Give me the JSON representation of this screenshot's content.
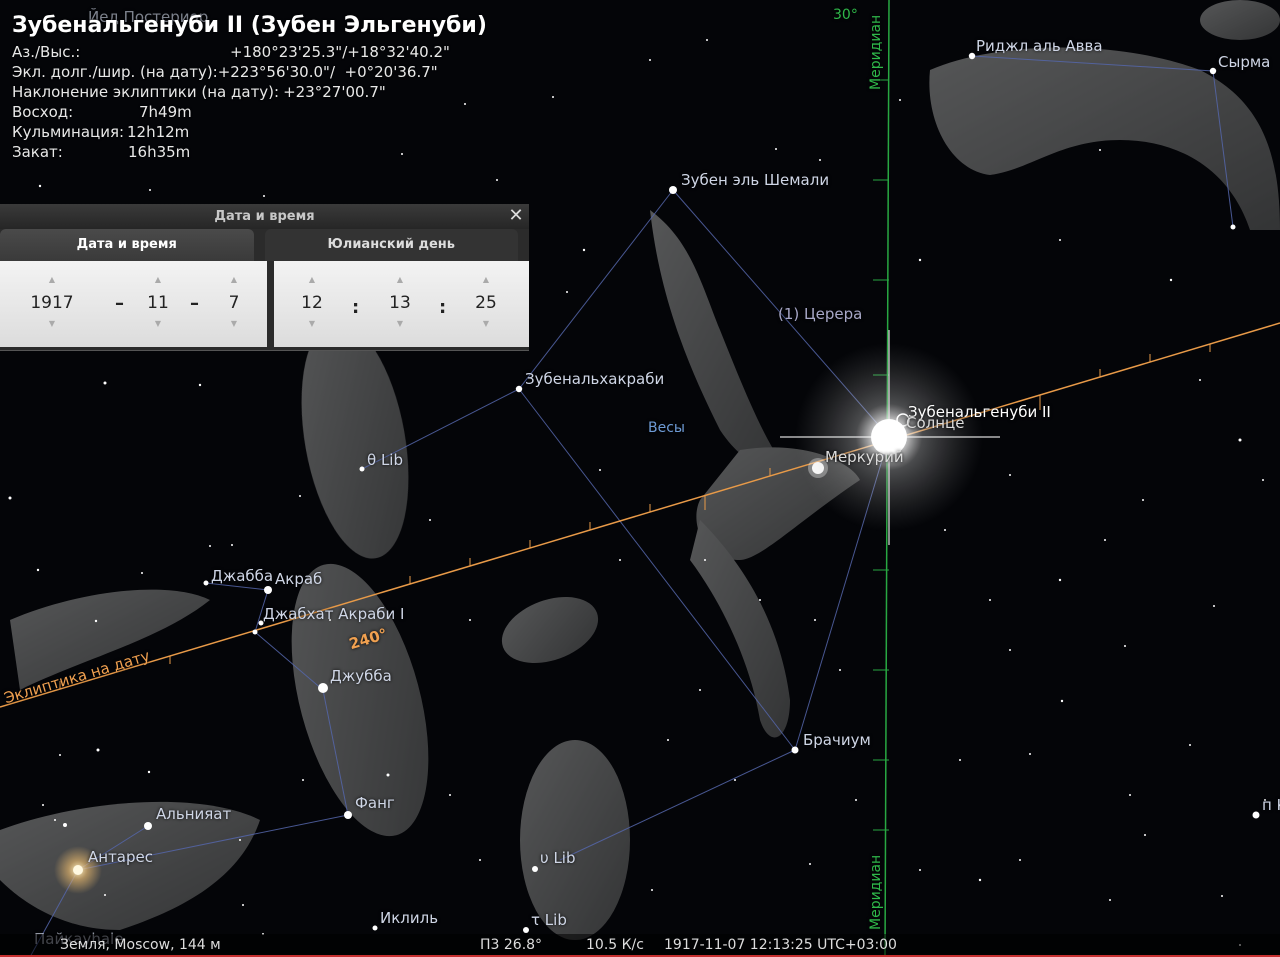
{
  "info": {
    "title": "Зубенальгенуби II (Зубен Эльгенуби)",
    "rows": [
      {
        "label": "Аз./Выс.:",
        "value": "+180°23'25.3\"/+18°32'40.2\""
      },
      {
        "label": "Экл. долг./шир. (на дату):",
        "value": "+223°56'30.0\"/  +0°20'36.7\""
      },
      {
        "label": "Наклонение эклиптики (на дату):",
        "value": "+23°27'00.7\""
      },
      {
        "label": "Восход:",
        "value": "7h49m"
      },
      {
        "label": "Кульминация:",
        "value": "12h12m"
      },
      {
        "label": "Закат:",
        "value": "16h35m"
      }
    ]
  },
  "dialog": {
    "title": "Дата и время",
    "close": "✕",
    "tabs": [
      "Дата и время",
      "Юлианский день"
    ],
    "date": {
      "year": "1917",
      "month": "11",
      "day": "7",
      "sep": "–"
    },
    "time": {
      "hour": "12",
      "minute": "13",
      "second": "25",
      "sep": ":"
    }
  },
  "labels": {
    "top_hidden": "Йед Постериор",
    "rigel_awwa": "Риджл аль Авва",
    "syrma": "Сырма",
    "zuben_eschamali": "Зубен эль Шемали",
    "ceres": "(1) Церера",
    "zubenalakrab": "Зубенальхакраби",
    "libra": "Весы",
    "theta_lib": "θ Lib",
    "zubenelgenubi": "Зубенальгенуби II",
    "sun": "Солнце",
    "mercury": "Меркурий",
    "jabbah": "Джабба",
    "akrab": "Акраб",
    "jabhat": "Джабхат Акраби I",
    "dschubba": "Джубба",
    "alniyat": "Альнияат",
    "fang": "Фанг",
    "antares": "Антарес",
    "brachium": "Брачиум",
    "upsilon_lib": "υ Lib",
    "tau_lib": "τ Lib",
    "iklil": "Иклиль",
    "paikauhale": "Пайкауhale",
    "right_edge": "п К",
    "ecliptic": "Эклиптика на дату",
    "ecl_tick": "240°",
    "meridian": "Меридиан",
    "merid_tick": "30°"
  },
  "status": {
    "location": "Земля, Moscow, 144 м",
    "fov": "П3 26.8°",
    "fps": "10.5 К/с",
    "datetime": "1917-11-07 12:13:25 UTC+03:00"
  },
  "colors": {
    "ecliptic": "#e89a48",
    "meridian": "#28a842",
    "constellation_lines": "#5566aa",
    "sky": "#040508"
  }
}
